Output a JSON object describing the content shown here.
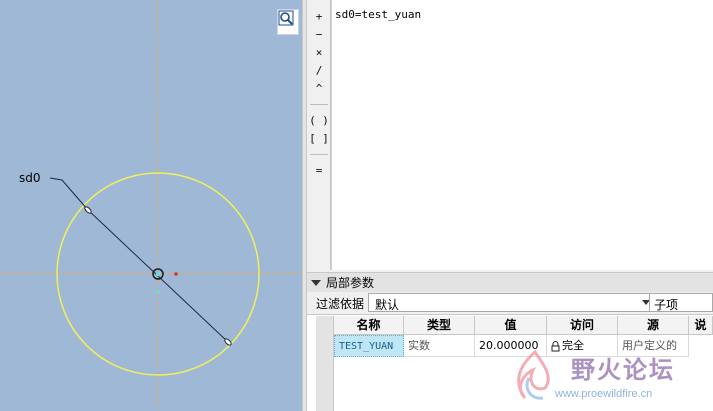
{
  "viewport": {
    "dimension_label": "sd0",
    "colors": {
      "background": "#9fb8d5",
      "circle": "#f2f05a",
      "centerline": "#e8a84a",
      "dimension": "#1e2a3a"
    }
  },
  "operators": [
    "+",
    "−",
    "×",
    "/",
    "^",
    "( )",
    "[ ]",
    "="
  ],
  "editor": {
    "text": "sd0=test_yuan"
  },
  "local_params": {
    "title": "局部参数",
    "filter_label": "过滤依据",
    "filter_value": "默认",
    "sub_label": "子项"
  },
  "table": {
    "columns": [
      "名称",
      "类型",
      "值",
      "访问",
      "源",
      "说"
    ],
    "rows": [
      {
        "name": "TEST_YUAN",
        "type": "实数",
        "value": "20.000000",
        "access": "完全",
        "source": "用户定义的"
      }
    ]
  },
  "watermark": {
    "title": "野火论坛",
    "url": "www.proewildfire.cn"
  }
}
